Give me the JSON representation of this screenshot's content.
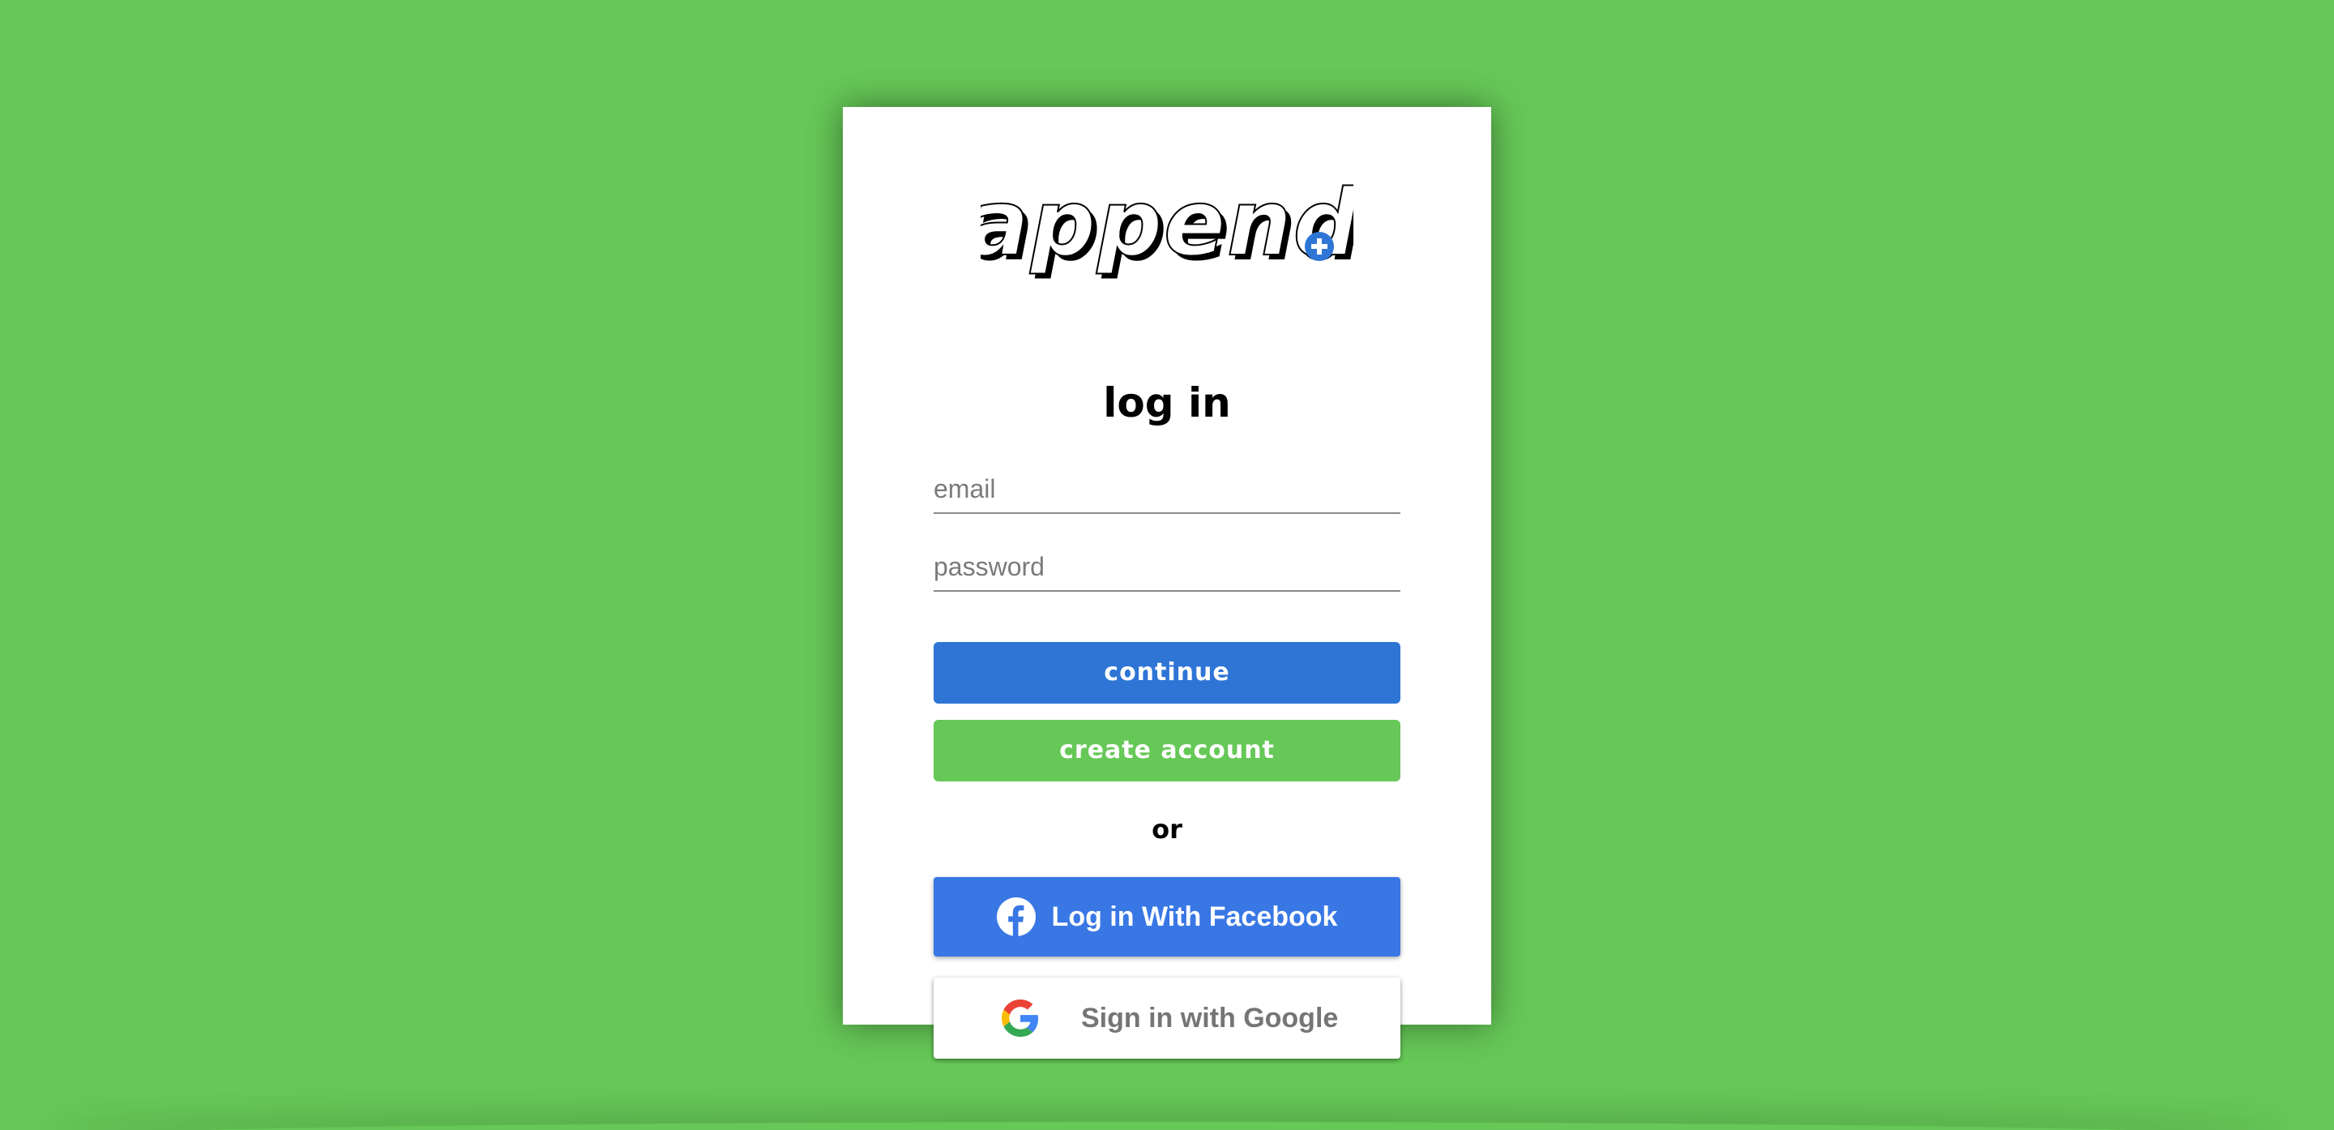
{
  "brand": {
    "logo_text": "append",
    "logo_badge_icon": "plus-icon",
    "accent_blue": "#2e75d6",
    "accent_green": "#66c857"
  },
  "form": {
    "title": "log in",
    "email_placeholder": "email",
    "password_placeholder": "password",
    "continue_label": "continue",
    "create_account_label": "create account",
    "separator": "or"
  },
  "social": {
    "facebook_label": "Log in With Facebook",
    "facebook_icon": "facebook-icon",
    "facebook_color": "#3977e5",
    "google_label": "Sign in with Google",
    "google_icon": "google-icon"
  }
}
